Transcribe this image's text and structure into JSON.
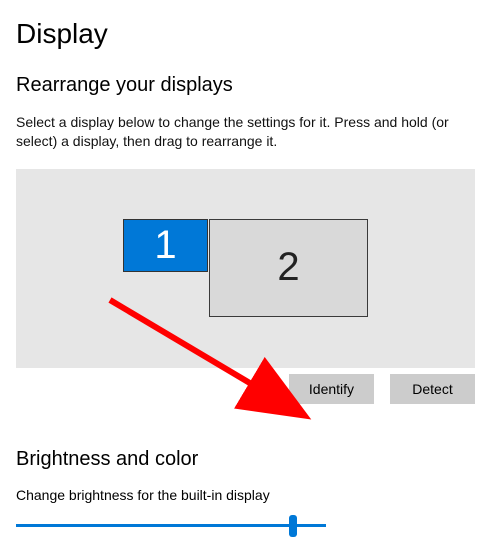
{
  "page": {
    "title": "Display"
  },
  "rearrange": {
    "heading": "Rearrange your displays",
    "description": "Select a display below to change the settings for it. Press and hold (or select) a display, then drag to rearrange it.",
    "displays": {
      "d1_label": "1",
      "d2_label": "2"
    },
    "identify_label": "Identify",
    "detect_label": "Detect"
  },
  "brightness": {
    "heading": "Brightness and color",
    "label": "Change brightness for the built-in display",
    "value": 89
  },
  "annotation": {
    "arrow_color": "#ff0000",
    "target": "identify-button"
  }
}
